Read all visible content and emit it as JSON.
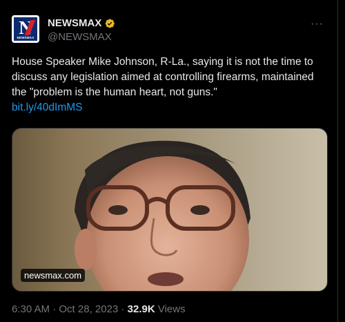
{
  "account": {
    "display_name": "NEWSMAX",
    "handle": "@NEWSMAX",
    "avatar_text": "N",
    "avatar_subtext": "NEWSMAX",
    "verified_color": "#e8b829"
  },
  "menu_icon": "more-horizontal-icon",
  "tweet": {
    "text": "House Speaker Mike Johnson, R-La., saying it is not the time to discuss any legislation aimed at controlling firearms, maintained the \"problem is the human heart, not guns.\"",
    "link": "bit.ly/40dImMS"
  },
  "media": {
    "domain": "newsmax.com"
  },
  "meta": {
    "time": "6:30 AM",
    "separator": "·",
    "date": "Oct 28, 2023",
    "views_count": "32.9K",
    "views_label": "Views"
  },
  "colors": {
    "background": "#000000",
    "text": "#e7e9ea",
    "secondary": "#71767b",
    "link": "#1d9bf0"
  }
}
